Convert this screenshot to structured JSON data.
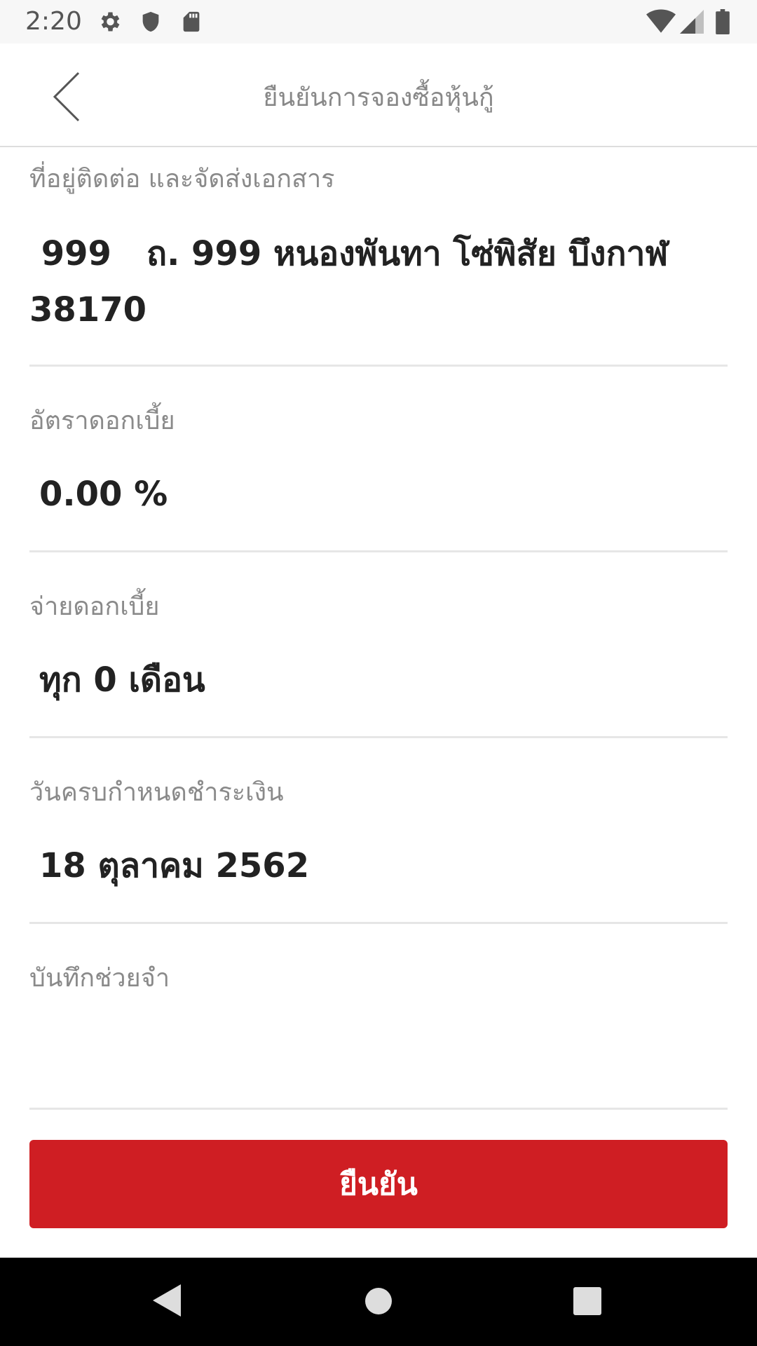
{
  "status_bar": {
    "time": "2:20",
    "icons": [
      "gear-icon",
      "shield-icon",
      "sd-card-icon",
      "wifi-icon",
      "signal-icon",
      "battery-icon"
    ]
  },
  "app_bar": {
    "title": "ยืนยันการจองซื้อหุ้นกู้",
    "back_icon": "chevron-left-icon"
  },
  "fields": [
    {
      "label": "ที่อยู่ติดต่อ และจัดส่งเอกสาร",
      "value_line1": " 999   ถ. 999 หนองพันทา โซ่พิสัย บึงกาฬ",
      "value_line2": "38170"
    },
    {
      "label": "อัตราดอกเบี้ย",
      "value": "0.00 %"
    },
    {
      "label": "จ่ายดอกเบี้ย",
      "value": "ทุก 0 เดือน"
    },
    {
      "label": "วันครบกำหนดชำระเงิน",
      "value": "18 ตุลาคม 2562"
    },
    {
      "label": "บันทึกช่วยจำ",
      "value": ""
    }
  ],
  "confirm_button": {
    "label": "ยืนยัน"
  },
  "colors": {
    "accent": "#cf1e23",
    "label": "#8a8a8a",
    "value": "#222222",
    "divider": "#e6e6e6"
  },
  "nav_bar": {
    "icons": [
      "back-triangle-icon",
      "home-circle-icon",
      "recents-square-icon"
    ]
  }
}
